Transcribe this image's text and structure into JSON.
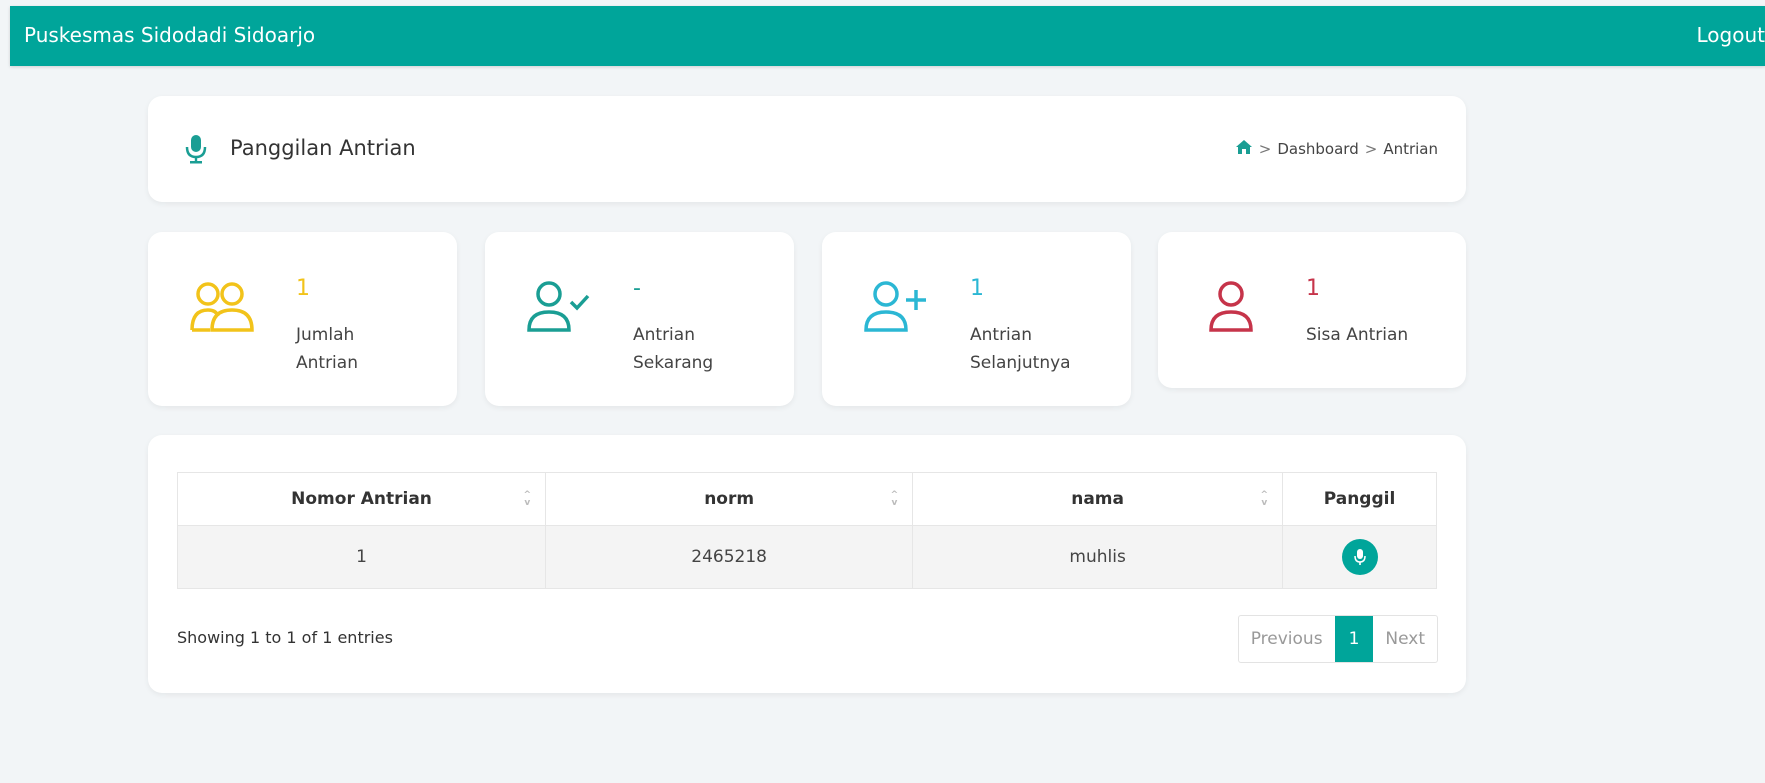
{
  "navbar": {
    "brand": "Puskesmas Sidodadi Sidoarjo",
    "logout": "Logout"
  },
  "header": {
    "title": "Panggilan Antrian",
    "breadcrumb": [
      "Dashboard",
      "Antrian"
    ],
    "separator": ">"
  },
  "stats": [
    {
      "value": "1",
      "label_line1": "Jumlah",
      "label_line2": "Antrian",
      "color": "#f2c31a",
      "icon": "users-icon"
    },
    {
      "value": "-",
      "label_line1": "Antrian",
      "label_line2": "Sekarang",
      "color": "#1a9e94",
      "icon": "user-check-icon"
    },
    {
      "value": "1",
      "label_line1": "Antrian",
      "label_line2": "Selanjutnya",
      "color": "#2bb7d4",
      "icon": "user-plus-icon"
    },
    {
      "value": "1",
      "label_line1": "Sisa Antrian",
      "label_line2": "",
      "color": "#c6344a",
      "icon": "user-icon"
    }
  ],
  "table": {
    "headers": [
      "Nomor Antrian",
      "norm",
      "nama",
      "Panggil"
    ],
    "rows": [
      {
        "nomor": "1",
        "norm": "2465218",
        "nama": "muhlis"
      }
    ]
  },
  "footer": {
    "info": "Showing 1 to 1 of 1 entries",
    "previous": "Previous",
    "page": "1",
    "next": "Next"
  },
  "colors": {
    "primary": "#00a59a"
  }
}
